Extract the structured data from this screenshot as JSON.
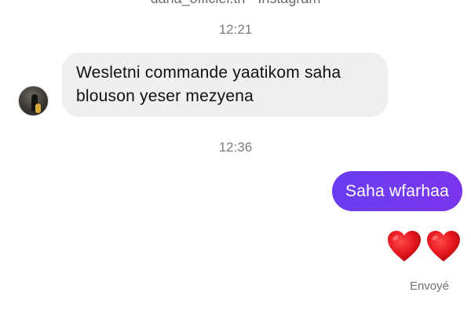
{
  "header": {
    "text": "dana_officiel.tn · Instagram"
  },
  "messages": {
    "timestamp_1": "12:21",
    "incoming": {
      "text": "Wesletni commande yaatikom saha blouson yeser mezyena",
      "avatar": "profile-photo"
    },
    "timestamp_2": "12:36",
    "outgoing": {
      "text": "Saha wfarhaa",
      "bubble_color": "#6e3bf0"
    },
    "reaction": {
      "icons": [
        "heart-icon",
        "heart-icon"
      ],
      "color": "#e0141e"
    },
    "status": "Envoyé"
  }
}
